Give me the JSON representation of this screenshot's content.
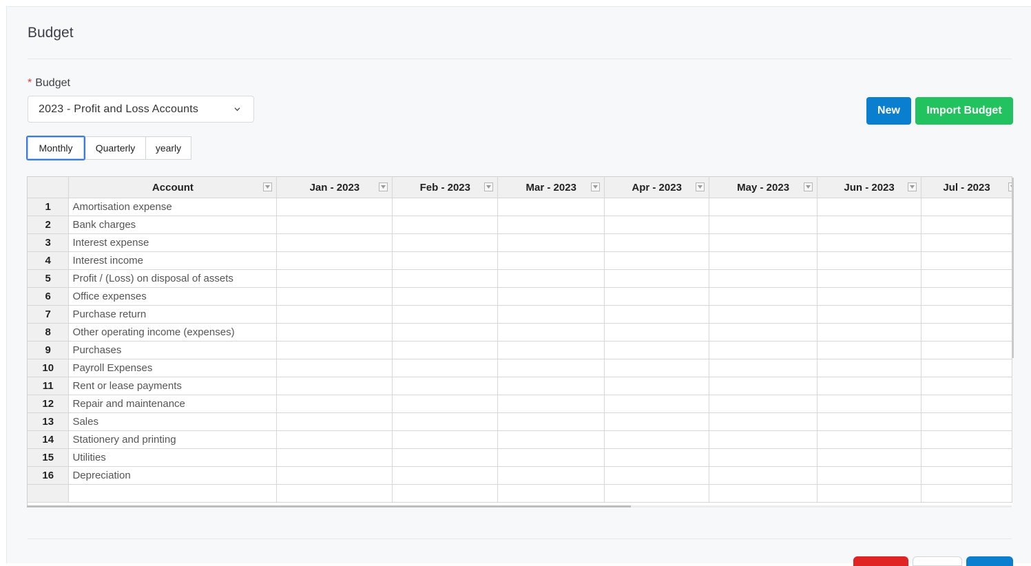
{
  "page": {
    "title": "Budget"
  },
  "budget_field": {
    "label": "Budget",
    "required_mark": "*",
    "selected_value": "2023 - Profit and Loss Accounts"
  },
  "actions": {
    "new_label": "New",
    "import_label": "Import Budget"
  },
  "period_tabs": [
    {
      "label": "Monthly",
      "active": true
    },
    {
      "label": "Quarterly",
      "active": false
    },
    {
      "label": "yearly",
      "active": false
    }
  ],
  "grid": {
    "account_header": "Account",
    "month_headers": [
      "Jan - 2023",
      "Feb - 2023",
      "Mar - 2023",
      "Apr - 2023",
      "May - 2023",
      "Jun - 2023",
      "Jul - 2023"
    ],
    "rows": [
      {
        "num": "1",
        "account": "Amortisation expense"
      },
      {
        "num": "2",
        "account": "Bank charges"
      },
      {
        "num": "3",
        "account": "Interest expense"
      },
      {
        "num": "4",
        "account": "Interest income"
      },
      {
        "num": "5",
        "account": "Profit / (Loss) on disposal of assets"
      },
      {
        "num": "6",
        "account": "Office expenses"
      },
      {
        "num": "7",
        "account": "Purchase return"
      },
      {
        "num": "8",
        "account": "Other operating income (expenses)"
      },
      {
        "num": "9",
        "account": "Purchases"
      },
      {
        "num": "10",
        "account": "Payroll Expenses"
      },
      {
        "num": "11",
        "account": "Rent or lease payments"
      },
      {
        "num": "12",
        "account": "Repair and maintenance"
      },
      {
        "num": "13",
        "account": "Sales"
      },
      {
        "num": "14",
        "account": "Stationery and printing"
      },
      {
        "num": "15",
        "account": "Utilities"
      },
      {
        "num": "16",
        "account": "Depreciation"
      }
    ]
  },
  "colors": {
    "primary": "#0a7fcf",
    "success": "#22c35e",
    "danger": "#e02424",
    "focus": "#3b7be0"
  }
}
